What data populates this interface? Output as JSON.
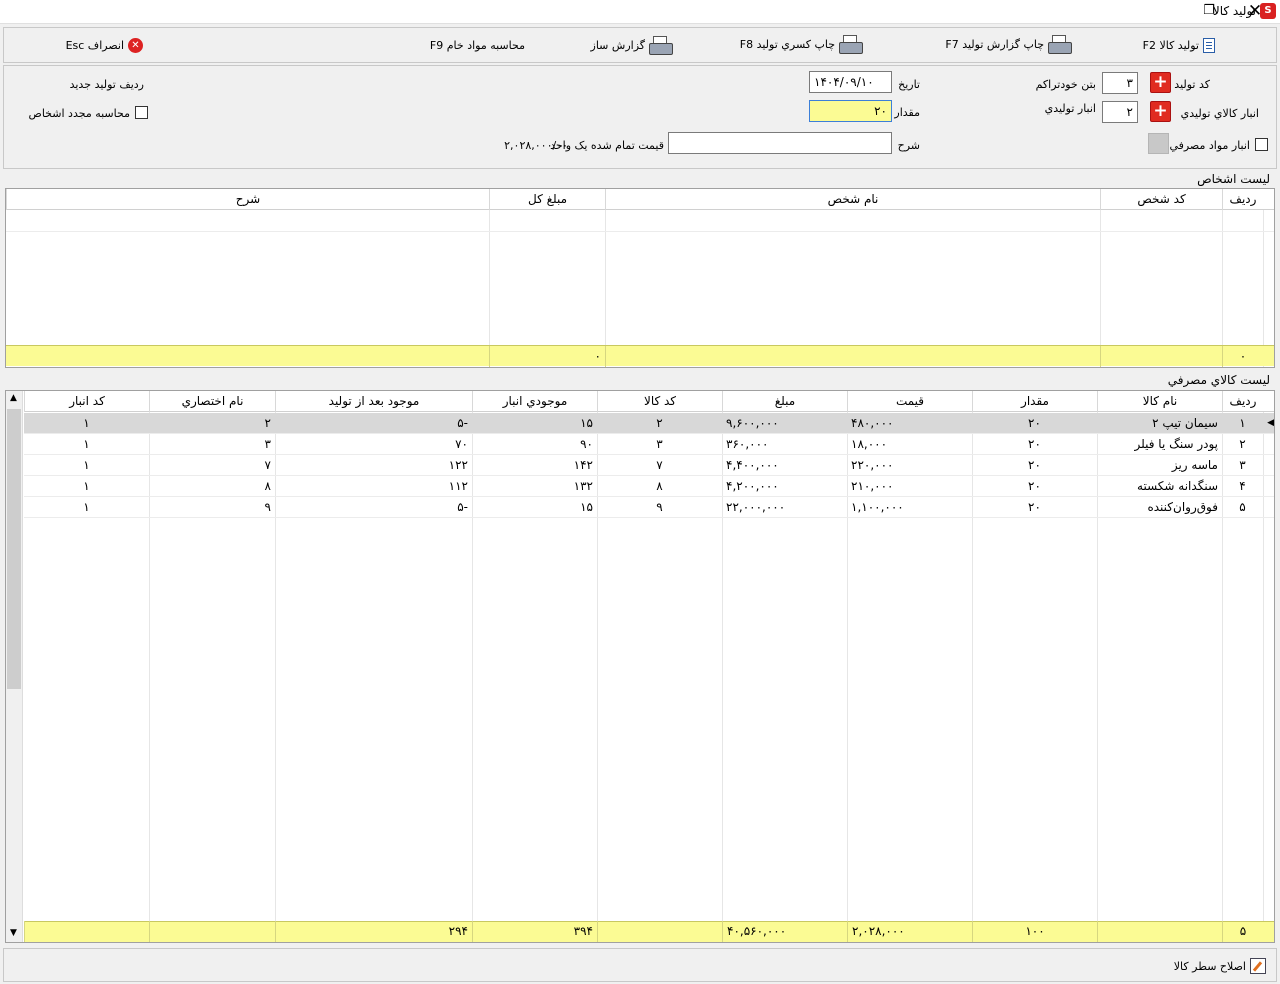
{
  "window": {
    "title": "تولید کالا",
    "app_icon": "S",
    "restore": "❐",
    "close": "✕"
  },
  "toolbar": {
    "produce": "تولید کالا F2",
    "print_report": "چاپ گزارش تولید F7",
    "print_shortage": "چاپ کسري تولید F8",
    "report_builder": "گزارش ساز",
    "calc_materials": "محاسبه مواد خام F9",
    "cancel": "انصراف Esc"
  },
  "form": {
    "code_label": "کد تولید",
    "code_value": "۳",
    "auto_label": "بتن خودتراکم",
    "warehouse_label": "انبار کالاي تولیدي",
    "warehouse_value": "۲",
    "warehouse_name": "انبار تولیدي",
    "consumable_label": "انبار مواد مصرفي",
    "date_label": "تاریخ",
    "date_value": "۱۴۰۴/۰۹/۱۰",
    "qty_label": "مقدار",
    "qty_value": "۲۰",
    "desc_label": "شرح",
    "desc_value": "",
    "unit_price_label": "قیمت تمام شده یک واحد",
    "unit_price_value": "۲,۰۲۸,۰۰۰/۰۰",
    "row_label": "ردیف تولید",
    "row_value": "جدید",
    "recalc_label": "محاسبه مجدد اشخاص"
  },
  "persons": {
    "title": "لیست اشخاص",
    "headers": [
      "ردیف",
      "کد شخص",
      "نام شخص",
      "مبلغ کل",
      "شرح"
    ],
    "footer": {
      "row": "۰",
      "total": "۰"
    }
  },
  "goods": {
    "title": "لیست کالاي مصرفي",
    "headers": [
      "ردیف",
      "نام کالا",
      "مقدار",
      "قیمت",
      "مبلغ",
      "کد کالا",
      "موجودي انبار",
      "موجود بعد از تولید",
      "نام اختصاري",
      "کد انبار"
    ],
    "rows": [
      {
        "row": "۱",
        "name": "سیمان تیپ ۲",
        "qty": "۲۰",
        "price": "۴۸۰,۰۰۰",
        "amount": "۹,۶۰۰,۰۰۰",
        "code": "۲",
        "stock": "۱۵",
        "after": "۵-",
        "short": "۲",
        "wh": "۱"
      },
      {
        "row": "۲",
        "name": "پودر سنگ یا فیلر",
        "qty": "۲۰",
        "price": "۱۸,۰۰۰",
        "amount": "۳۶۰,۰۰۰",
        "code": "۳",
        "stock": "۹۰",
        "after": "۷۰",
        "short": "۳",
        "wh": "۱"
      },
      {
        "row": "۳",
        "name": "ماسه ریز",
        "qty": "۲۰",
        "price": "۲۲۰,۰۰۰",
        "amount": "۴,۴۰۰,۰۰۰",
        "code": "۷",
        "stock": "۱۴۲",
        "after": "۱۲۲",
        "short": "۷",
        "wh": "۱"
      },
      {
        "row": "۴",
        "name": "سنگدانه شکسته",
        "qty": "۲۰",
        "price": "۲۱۰,۰۰۰",
        "amount": "۴,۲۰۰,۰۰۰",
        "code": "۸",
        "stock": "۱۳۲",
        "after": "۱۱۲",
        "short": "۸",
        "wh": "۱"
      },
      {
        "row": "۵",
        "name": "فوق‌روان‌کننده",
        "qty": "۲۰",
        "price": "۱,۱۰۰,۰۰۰",
        "amount": "۲۲,۰۰۰,۰۰۰",
        "code": "۹",
        "stock": "۱۵",
        "after": "۵-",
        "short": "۹",
        "wh": "۱"
      }
    ],
    "footer": {
      "row": "۵",
      "qty": "۱۰۰",
      "price": "۲,۰۲۸,۰۰۰",
      "amount": "۴۰,۵۶۰,۰۰۰",
      "stock": "۳۹۴",
      "after": "۲۹۴"
    }
  },
  "status": {
    "fix_row": "اصلاح سطر کالا"
  },
  "colors": {
    "highlight": "#fbfb94",
    "selected_row": "#d8d8d8",
    "accent_red": "#e02b20"
  },
  "icons": {
    "printer": "printer-icon",
    "document": "document-icon",
    "cancel": "cancel-icon",
    "plus": "plus-icon",
    "edit": "edit-icon"
  }
}
